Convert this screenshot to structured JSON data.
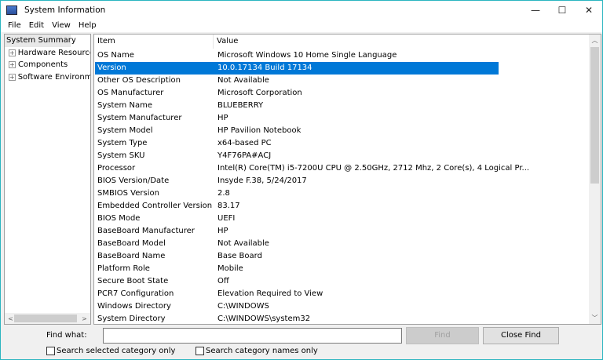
{
  "window": {
    "title": "System Information",
    "controls": [
      "—",
      "☐",
      "✕"
    ]
  },
  "menu": [
    "File",
    "Edit",
    "View",
    "Help"
  ],
  "tree": {
    "selected": "System Summary",
    "items": [
      "Hardware Resources",
      "Components",
      "Software Environment"
    ]
  },
  "table": {
    "headers": [
      "Item",
      "Value"
    ],
    "selected_index": 1,
    "rows": [
      [
        "OS Name",
        "Microsoft Windows 10 Home Single Language"
      ],
      [
        "Version",
        "10.0.17134 Build 17134"
      ],
      [
        "Other OS Description",
        "Not Available"
      ],
      [
        "OS Manufacturer",
        "Microsoft Corporation"
      ],
      [
        "System Name",
        "BLUEBERRY"
      ],
      [
        "System Manufacturer",
        "HP"
      ],
      [
        "System Model",
        "HP Pavilion Notebook"
      ],
      [
        "System Type",
        "x64-based PC"
      ],
      [
        "System SKU",
        "Y4F76PA#ACJ"
      ],
      [
        "Processor",
        "Intel(R) Core(TM) i5-7200U CPU @ 2.50GHz, 2712 Mhz, 2 Core(s), 4 Logical Pr..."
      ],
      [
        "BIOS Version/Date",
        "Insyde F.38, 5/24/2017"
      ],
      [
        "SMBIOS Version",
        "2.8"
      ],
      [
        "Embedded Controller Version",
        "83.17"
      ],
      [
        "BIOS Mode",
        "UEFI"
      ],
      [
        "BaseBoard Manufacturer",
        "HP"
      ],
      [
        "BaseBoard Model",
        "Not Available"
      ],
      [
        "BaseBoard Name",
        "Base Board"
      ],
      [
        "Platform Role",
        "Mobile"
      ],
      [
        "Secure Boot State",
        "Off"
      ],
      [
        "PCR7 Configuration",
        "Elevation Required to View"
      ],
      [
        "Windows Directory",
        "C:\\WINDOWS"
      ],
      [
        "System Directory",
        "C:\\WINDOWS\\system32"
      ]
    ]
  },
  "find": {
    "label": "Find what:",
    "value": "",
    "find_button": "Find",
    "close_button": "Close Find",
    "check1": "Search selected category only",
    "check2": "Search category names only"
  },
  "colors": {
    "selection": "#0078d7",
    "border": "#2bb5c0"
  }
}
